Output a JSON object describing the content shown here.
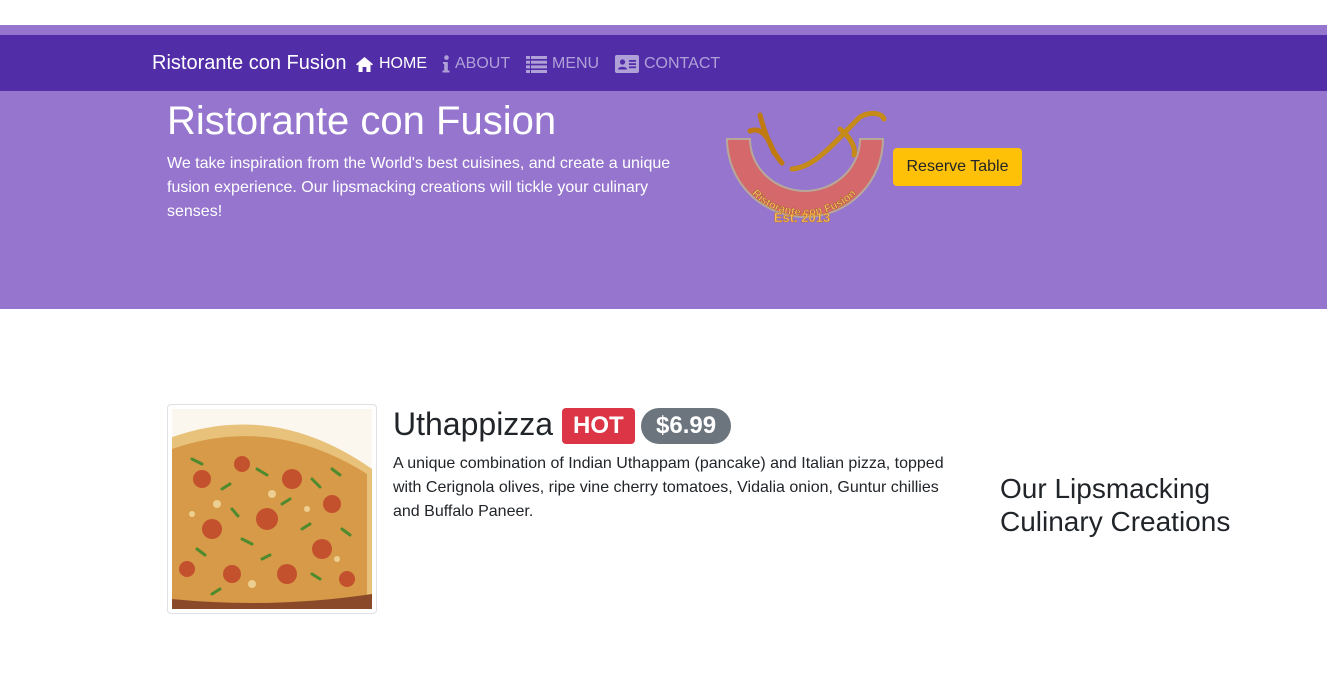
{
  "navbar": {
    "brand": "Ristorante con Fusion",
    "items": [
      {
        "label": "HOME",
        "icon": "home-icon",
        "active": true
      },
      {
        "label": "ABOUT",
        "icon": "info-icon",
        "active": false
      },
      {
        "label": "MENU",
        "icon": "list-icon",
        "active": false
      },
      {
        "label": "CONTACT",
        "icon": "address-card-icon",
        "active": false
      }
    ]
  },
  "jumbotron": {
    "title": "Ristorante con Fusion",
    "text": "We take inspiration from the World's best cuisines, and create a unique fusion experience. Our lipsmacking creations will tickle your culinary senses!",
    "logo": {
      "arc_text": "Ristorante con Fusion",
      "est_text": "Est. 2013"
    },
    "reserve_label": "Reserve Table"
  },
  "featured_dish": {
    "name": "Uthappizza",
    "badge": "HOT",
    "price": "$6.99",
    "description": "A unique combination of Indian Uthappam (pancake) and Italian pizza, topped with Cerignola olives, ripe vine cherry tomatoes, Vidalia onion, Guntur chillies and Buffalo Paneer."
  },
  "side": {
    "heading": "Our Lipsmacking Culinary Creations"
  },
  "colors": {
    "navbar": "#512da8",
    "jumbotron": "#9575cd",
    "reserve_button": "#ffc107",
    "badge_hot": "#dc3545",
    "badge_price": "#6c757d"
  }
}
